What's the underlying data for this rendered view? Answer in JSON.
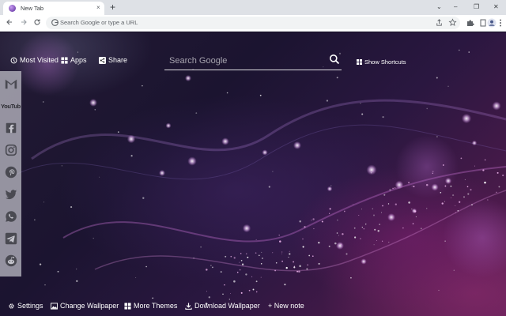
{
  "browser": {
    "tab_title": "New Tab",
    "close_glyph": "×",
    "new_tab_glyph": "+",
    "omnibox_placeholder": "Search Google or type a URL",
    "window_controls": [
      "⌄",
      "–",
      "❐",
      "✕"
    ]
  },
  "toolbar_icons": [
    "back-arrow-icon",
    "forward-arrow-icon",
    "reload-icon",
    "google-g-icon",
    "share-icon",
    "star-icon",
    "extensions-puzzle-icon",
    "reading-list-icon",
    "profile-icon",
    "menu-kebab-icon"
  ],
  "top_links": {
    "most_visited": "Most Visited",
    "apps": "Apps",
    "share": "Share"
  },
  "search": {
    "placeholder": "Search Google"
  },
  "shortcuts": {
    "label": "Show Shortcuts"
  },
  "sidebar": {
    "items": [
      "gmail-icon",
      "youtube-icon",
      "facebook-icon",
      "instagram-icon",
      "pinterest-icon",
      "twitter-icon",
      "whatsapp-icon",
      "telegram-icon",
      "reddit-icon"
    ],
    "youtube_wordmark": "YouTube"
  },
  "bottom_bar": {
    "settings": "Settings",
    "change_wallpaper": "Change Wallpaper",
    "more_themes": "More Themes",
    "download_wallpaper": "Download Wallpaper",
    "new_note": "+ New note"
  },
  "colors": {
    "accent_purple": "#8a3fbf",
    "wallpaper_dark": "#1b1430",
    "wallpaper_magenta": "#5a1d52",
    "sidebar_gray": "#c4c4cc"
  }
}
